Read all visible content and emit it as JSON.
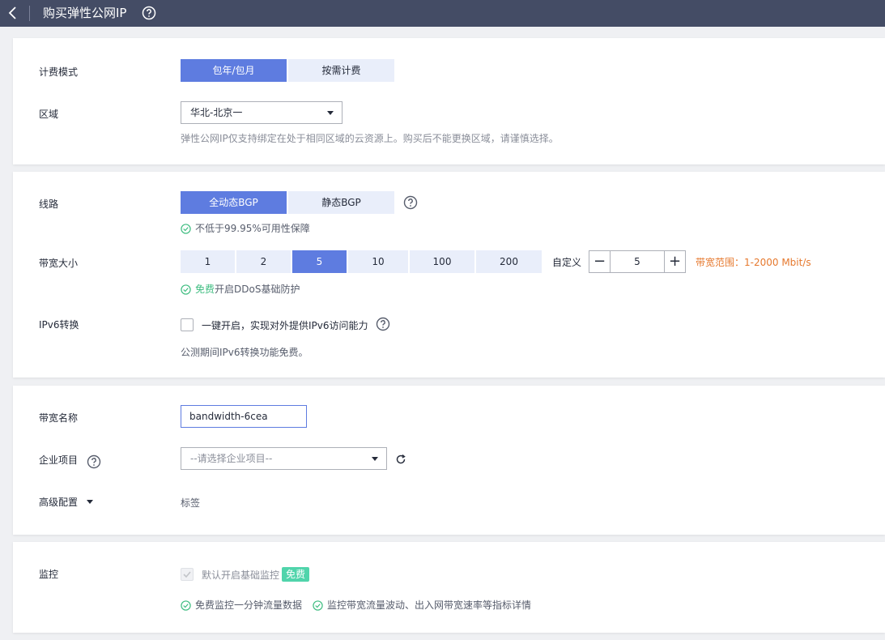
{
  "header": {
    "title": "购买弹性公网IP"
  },
  "billing": {
    "label": "计费模式",
    "options": [
      "包年/包月",
      "按需计费"
    ],
    "active": 0
  },
  "region": {
    "label": "区域",
    "value": "华北-北京一",
    "hint": "弹性公网IP仅支持绑定在处于相同区域的云资源上。购买后不能更换区域，请谨慎选择。"
  },
  "line": {
    "label": "线路",
    "options": [
      "全动态BGP",
      "静态BGP"
    ],
    "active": 0,
    "availability": "不低于99.95%可用性保障"
  },
  "bandwidth": {
    "label": "带宽大小",
    "presets": [
      "1",
      "2",
      "5",
      "10",
      "100",
      "200"
    ],
    "active": 2,
    "custom_label": "自定义",
    "value": "5",
    "range": "带宽范围：1-2000 Mbit/s",
    "ddos_free": "免费",
    "ddos_text": "开启DDoS基础防护"
  },
  "ipv6": {
    "label": "IPv6转换",
    "checkbox_label": "一键开启，实现对外提供IPv6访问能力",
    "checked": false,
    "hint": "公测期间IPv6转换功能免费。"
  },
  "bandwidth_name": {
    "label": "带宽名称",
    "value": "bandwidth-6cea"
  },
  "enterprise_project": {
    "label": "企业项目",
    "placeholder": "--请选择企业项目--"
  },
  "advanced": {
    "label": "高级配置",
    "tag_label": "标签"
  },
  "monitor": {
    "label": "监控",
    "checkbox_label": "默认开启基础监控",
    "badge": "免费",
    "feature1": "免费监控一分钟流量数据",
    "feature2": "监控带宽流量波动、出入网带宽速率等指标详情"
  },
  "colors": {
    "header_bg": "#444c65",
    "primary": "#5e7ce0",
    "segment_bg": "#e9eefa",
    "success": "#3fbd81",
    "warning_text": "#e6792e",
    "badge_bg": "#50d4ab"
  }
}
